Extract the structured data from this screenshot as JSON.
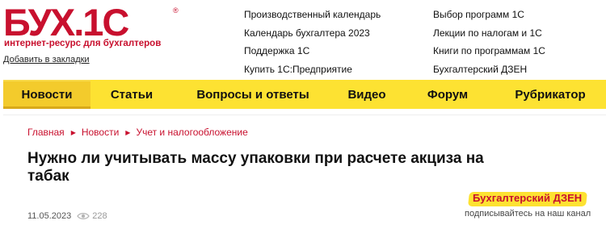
{
  "logo": {
    "brand": "БУХ.1С",
    "registered": "®",
    "tagline": "интернет-ресурс для бухгалтеров"
  },
  "bookmark_label": "Добавить в закладки",
  "top_links": {
    "col1": [
      "Производственный календарь",
      "Календарь бухгалтера 2023",
      "Поддержка 1С",
      "Купить 1С:Предприятие"
    ],
    "col2": [
      "Выбор программ 1С",
      "Лекции по налогам и 1С",
      "Книги по программам 1С",
      "Бухгалтерский ДЗЕН"
    ]
  },
  "nav": {
    "items": [
      "Новости",
      "Статьи",
      "Вопросы и ответы",
      "Видео",
      "Форум",
      "Рубрикатор"
    ],
    "active": "Новости"
  },
  "breadcrumb": [
    "Главная",
    "Новости",
    "Учет и налогообложение"
  ],
  "article": {
    "title": "Нужно ли учитывать массу упаковки при расчете акциза на табак",
    "date": "11.05.2023",
    "views": "228"
  },
  "dzen": {
    "title": "Бухгалтерский ДЗЕН",
    "subtitle": "подписывайтесь на наш канал"
  },
  "colors": {
    "brand_red": "#c8102e",
    "nav_yellow": "#fde232",
    "nav_active": "#f3cb2c"
  }
}
